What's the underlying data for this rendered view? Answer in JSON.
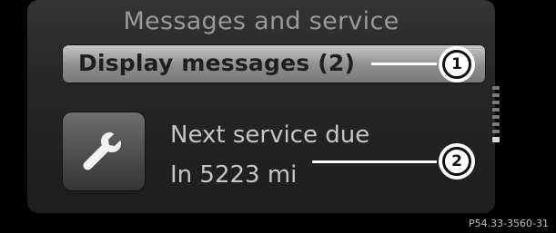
{
  "header": {
    "title": "Messages and service"
  },
  "menu": {
    "display_messages_label": "Display messages (2)"
  },
  "service": {
    "icon": "wrench-icon",
    "line1": "Next service due",
    "line2": "In 5223 mi"
  },
  "callouts": [
    "1",
    "2"
  ],
  "figure": {
    "ref_code": "P54.33-3560-31"
  },
  "colors": {
    "screen_bg": "#2a2a2a",
    "highlight": "#a8a8a8",
    "text": "#c6c6c6"
  }
}
